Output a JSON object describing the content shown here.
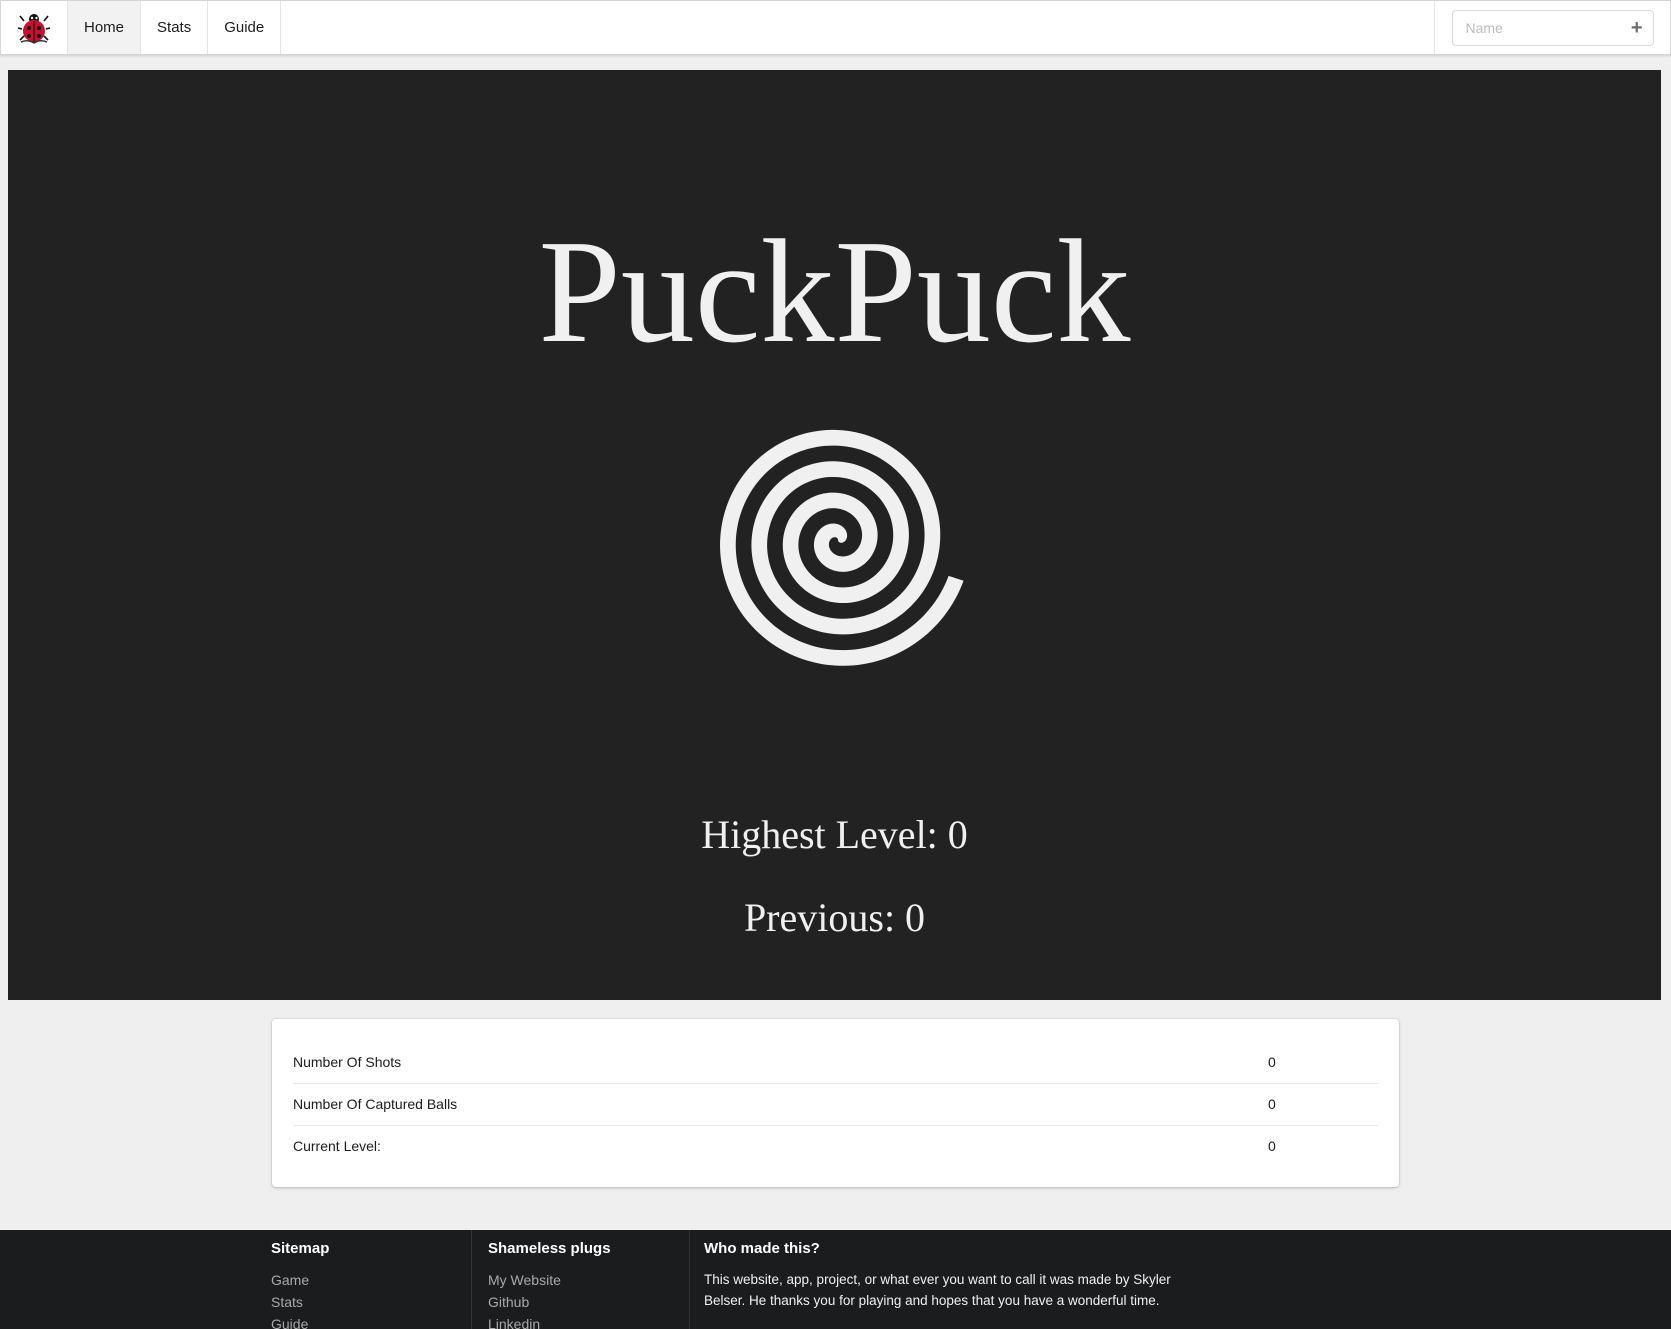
{
  "nav": {
    "logo_icon": "ladybug-logo-icon",
    "items": [
      {
        "label": "Home",
        "active": true
      },
      {
        "label": "Stats",
        "active": false
      },
      {
        "label": "Guide",
        "active": false
      }
    ],
    "name_input": {
      "placeholder": "Name",
      "value": ""
    },
    "add_icon": "plus-icon"
  },
  "game": {
    "title": "PuckPuck",
    "spiral_icon": "spiral-icon",
    "highest_level": "Highest Level: 0",
    "previous": "Previous: 0",
    "background_color": "#222222",
    "foreground_color": "#f0f0f0"
  },
  "stats": {
    "rows": [
      {
        "label": "Number Of Shots",
        "value": "0"
      },
      {
        "label": "Number Of Captured Balls",
        "value": "0"
      },
      {
        "label": "Current Level:",
        "value": "0"
      }
    ]
  },
  "footer": {
    "sitemap": {
      "heading": "Sitemap",
      "links": [
        "Game",
        "Stats",
        "Guide"
      ]
    },
    "plugs": {
      "heading": "Shameless plugs",
      "links": [
        "My Website",
        "Github",
        "Linkedin"
      ]
    },
    "about": {
      "heading": "Who made this?",
      "text": "This website, app, project, or what ever you want to call it was made by Skyler Belser. He thanks you for playing and hopes that you have a wonderful time."
    }
  }
}
